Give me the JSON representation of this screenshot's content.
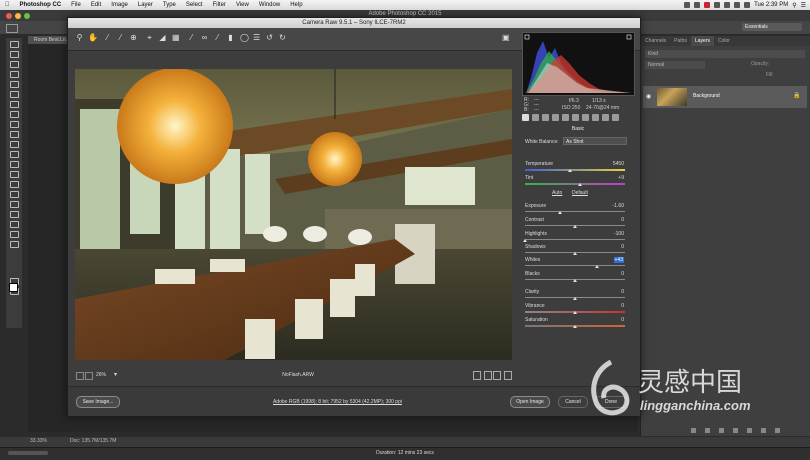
{
  "menubar": {
    "app_name": "Photoshop CC",
    "items": [
      "File",
      "Edit",
      "Image",
      "Layer",
      "Type",
      "Select",
      "Filter",
      "View",
      "Window",
      "Help"
    ],
    "clock": "Tue 2:39 PM"
  },
  "photoshop": {
    "window_title": "Adobe Photoshop CC 2015",
    "workspace": "Essentials",
    "doc_tab": "Room Best.Ln...",
    "status_zoom": "33.33%",
    "status_doc": "Doc: 135.7M/135.7M",
    "duration": "Duration: 12 mins 23 secs"
  },
  "layers_panel": {
    "tabs": [
      "Channels",
      "Paths",
      "Layers",
      "Color"
    ],
    "active_tab": "Layers",
    "filter_label": "Kind",
    "blend_mode": "Normal",
    "opacity_label": "Opacity:",
    "fill_label": "Fill:",
    "layer_name": "Background"
  },
  "camera_raw": {
    "title": "Camera Raw 9.5.1 – Sony ILCE-7RM2",
    "rgb_readout": {
      "r_label": "R:",
      "g_label": "G:",
      "b_label": "B:",
      "r_value": "---",
      "g_value": "---",
      "b_value": "---",
      "aperture": "f/6.3",
      "shutter": "1/13 s",
      "iso": "ISO 250",
      "lens": "24-70@24 mm"
    },
    "panel_title": "Basic",
    "white_balance_label": "White Balance:",
    "white_balance_value": "As Shot",
    "auto_label": "Auto",
    "default_label": "Default",
    "sliders": [
      {
        "label": "Temperature",
        "value": "5450",
        "level": 0.45
      },
      {
        "label": "Tint",
        "value": "+9",
        "level": 0.55
      },
      {
        "label": "Exposure",
        "value": "-1.60",
        "level": 0.35
      },
      {
        "label": "Contrast",
        "value": "0",
        "level": 0.5
      },
      {
        "label": "Highlights",
        "value": "-100",
        "level": 0.0
      },
      {
        "label": "Shadows",
        "value": "0",
        "level": 0.5
      },
      {
        "label": "Whites",
        "value": "+43",
        "level": 0.72
      },
      {
        "label": "Blacks",
        "value": "0",
        "level": 0.5
      },
      {
        "label": "Clarity",
        "value": "0",
        "level": 0.5
      },
      {
        "label": "Vibrance",
        "value": "0",
        "level": 0.5
      },
      {
        "label": "Saturation",
        "value": "0",
        "level": 0.5
      }
    ],
    "zoom_value": "26%",
    "filename": "NoFlash.ARW",
    "save_button": "Save Image...",
    "workflow_link": "Adobe RGB (1998); 8 bit; 7952 by 5304 (42.2MP); 300 ppi",
    "open_button": "Open Image",
    "cancel_button": "Cancel",
    "done_button": "Done"
  },
  "watermark": {
    "chinese": "灵感中国",
    "url": "lingganchina.com"
  }
}
